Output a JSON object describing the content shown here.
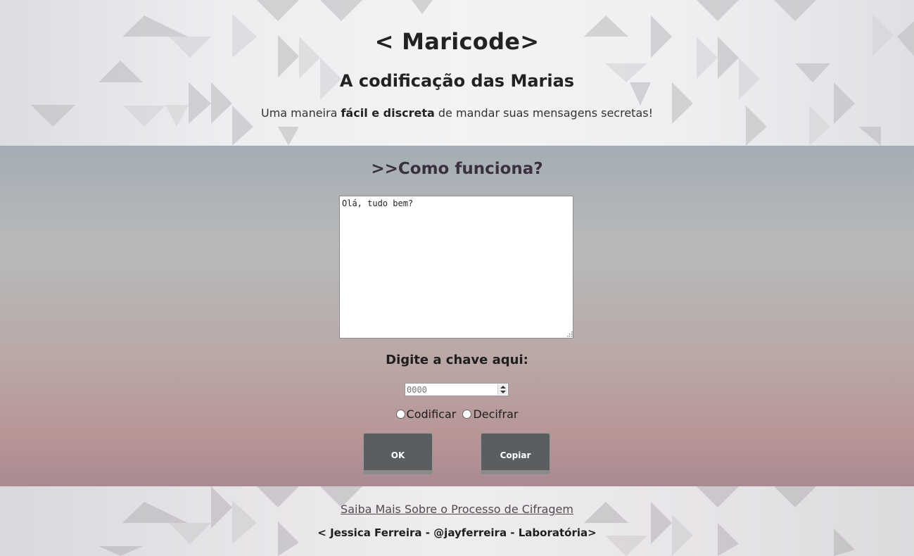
{
  "header": {
    "title": "< Maricode>",
    "subtitle": "A codificação das Marias",
    "tagline_prefix": "Uma maneira ",
    "tagline_bold": "fácil e discreta",
    "tagline_suffix": " de mandar suas mensagens secretas!"
  },
  "main": {
    "section_title": ">>Como funciona?",
    "message_value": "Olá, tudo bem?",
    "key_label": "Digite a chave aqui:",
    "key_placeholder": "0000",
    "mode_options": [
      "Codificar",
      "Decifrar"
    ],
    "ok_label": "OK",
    "copy_label": "Copiar"
  },
  "footer": {
    "learn_more": "Saiba Mais Sobre o Processo de Cifragem",
    "credits": "< Jessica Ferreira - @jayferreira - Laboratória>"
  },
  "colors": {
    "button_bg": "#5b5e60",
    "title_text": "#222222",
    "section_title": "#3a3040"
  }
}
